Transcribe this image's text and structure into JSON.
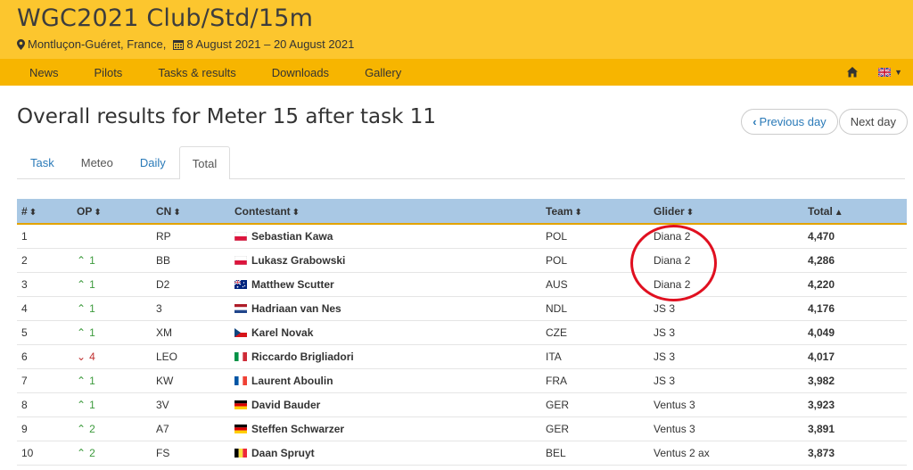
{
  "header": {
    "title": "WGC2021 Club/Std/15m",
    "location": "Montluçon-Guéret, France,",
    "dates": "8 August 2021 – 20 August 2021"
  },
  "nav": {
    "items": [
      "News",
      "Pilots",
      "Tasks & results",
      "Downloads",
      "Gallery"
    ]
  },
  "page": {
    "title": "Overall results for Meter 15 after task 11",
    "prev_label": "Previous day",
    "next_label": "Next day"
  },
  "tabs": [
    "Task",
    "Meteo",
    "Daily",
    "Total"
  ],
  "table": {
    "headers": [
      "#",
      "OP",
      "CN",
      "Contestant",
      "Team",
      "Glider",
      "Total"
    ],
    "rows": [
      {
        "rank": "1",
        "op": "",
        "op_dir": "",
        "cn": "RP",
        "name": "Sebastian Kawa",
        "flag": "pol",
        "team": "POL",
        "glider": "Diana 2",
        "total": "4,470"
      },
      {
        "rank": "2",
        "op": "1",
        "op_dir": "up",
        "cn": "BB",
        "name": "Lukasz Grabowski",
        "flag": "pol",
        "team": "POL",
        "glider": "Diana 2",
        "total": "4,286"
      },
      {
        "rank": "3",
        "op": "1",
        "op_dir": "up",
        "cn": "D2",
        "name": "Matthew Scutter",
        "flag": "aus",
        "team": "AUS",
        "glider": "Diana 2",
        "total": "4,220"
      },
      {
        "rank": "4",
        "op": "1",
        "op_dir": "up",
        "cn": "3",
        "name": "Hadriaan van Nes",
        "flag": "ndl",
        "team": "NDL",
        "glider": "JS 3",
        "total": "4,176"
      },
      {
        "rank": "5",
        "op": "1",
        "op_dir": "up",
        "cn": "XM",
        "name": "Karel Novak",
        "flag": "cze",
        "team": "CZE",
        "glider": "JS 3",
        "total": "4,049"
      },
      {
        "rank": "6",
        "op": "4",
        "op_dir": "down",
        "cn": "LEO",
        "name": "Riccardo Brigliadori",
        "flag": "ita",
        "team": "ITA",
        "glider": "JS 3",
        "total": "4,017"
      },
      {
        "rank": "7",
        "op": "1",
        "op_dir": "up",
        "cn": "KW",
        "name": "Laurent Aboulin",
        "flag": "fra",
        "team": "FRA",
        "glider": "JS 3",
        "total": "3,982"
      },
      {
        "rank": "8",
        "op": "1",
        "op_dir": "up",
        "cn": "3V",
        "name": "David Bauder",
        "flag": "ger",
        "team": "GER",
        "glider": "Ventus 3",
        "total": "3,923"
      },
      {
        "rank": "9",
        "op": "2",
        "op_dir": "up",
        "cn": "A7",
        "name": "Steffen Schwarzer",
        "flag": "ger",
        "team": "GER",
        "glider": "Ventus 3",
        "total": "3,891"
      },
      {
        "rank": "10",
        "op": "2",
        "op_dir": "up",
        "cn": "FS",
        "name": "Daan Spruyt",
        "flag": "bel",
        "team": "BEL",
        "glider": "Ventus 2 ax",
        "total": "3,873"
      }
    ]
  },
  "colors": {
    "header_bg": "#fcc62e",
    "nav_bg": "#f7b500",
    "table_header_bg": "#a9c8e4",
    "link": "#2a7ab8",
    "up": "#3c9a3c",
    "down": "#c03030",
    "annotation": "#e01020"
  }
}
